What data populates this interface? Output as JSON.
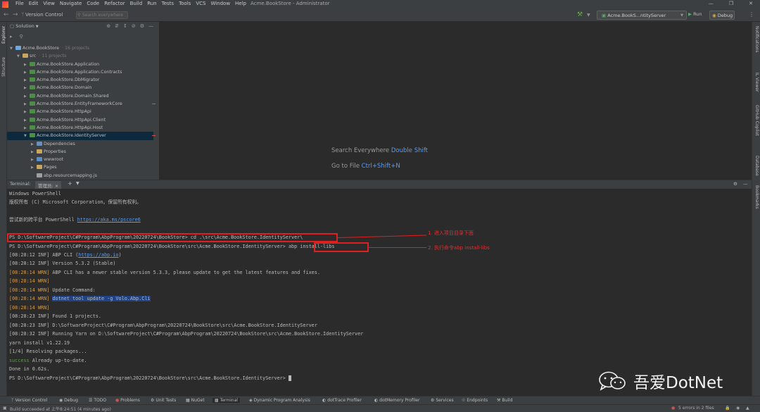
{
  "window": {
    "title": "Acme.BookStore - Administrator",
    "menu": [
      "File",
      "Edit",
      "View",
      "Navigate",
      "Code",
      "Refactor",
      "Build",
      "Run",
      "Tests",
      "Tools",
      "VCS",
      "Window",
      "Help"
    ],
    "controls": [
      "—",
      "❐",
      "✕"
    ]
  },
  "navbar": {
    "vcs_label": "Version Control",
    "search_placeholder": "Search everywhere",
    "run_config": "Acme.BookS...ntityServer",
    "run_label": "Run",
    "debug_label": "Debug"
  },
  "left_stripe": {
    "explorer": "Explorer",
    "structure": "Structure"
  },
  "right_stripe": [
    "Notifications",
    "IL Viewer",
    "GitHub Copilot",
    "Database",
    "Bookmarks"
  ],
  "explorer": {
    "header": "Solution",
    "tree": [
      {
        "label": "Acme.BookStore",
        "sub": "· 16 projects",
        "level": 0,
        "arrow": "down",
        "icon": "#6fa8dc"
      },
      {
        "label": "src",
        "sub": "· 11 projects",
        "level": 1,
        "arrow": "down",
        "icon": "#c9a65d"
      },
      {
        "label": "Acme.BookStore.Application",
        "level": 2,
        "arrow": "right",
        "icon": "#4a8f45"
      },
      {
        "label": "Acme.BookStore.Application.Contracts",
        "level": 2,
        "arrow": "right",
        "icon": "#4a8f45"
      },
      {
        "label": "Acme.BookStore.DbMigrator",
        "level": 2,
        "arrow": "right",
        "icon": "#4a8f45"
      },
      {
        "label": "Acme.BookStore.Domain",
        "level": 2,
        "arrow": "right",
        "icon": "#4a8f45"
      },
      {
        "label": "Acme.BookStore.Domain.Shared",
        "level": 2,
        "arrow": "right",
        "icon": "#4a8f45"
      },
      {
        "label": "Acme.BookStore.EntityFrameworkCore",
        "level": 2,
        "arrow": "right",
        "icon": "#4a8f45",
        "error": true
      },
      {
        "label": "Acme.BookStore.HttpApi",
        "level": 2,
        "arrow": "right",
        "icon": "#4a8f45"
      },
      {
        "label": "Acme.BookStore.HttpApi.Client",
        "level": 2,
        "arrow": "right",
        "icon": "#4a8f45"
      },
      {
        "label": "Acme.BookStore.HttpApi.Host",
        "level": 2,
        "arrow": "right",
        "icon": "#4a8f45"
      },
      {
        "label": "Acme.BookStore.IdentityServer",
        "level": 2,
        "arrow": "down",
        "icon": "#4a8f45",
        "selected": true,
        "error": true
      },
      {
        "label": "Dependencies",
        "level": 3,
        "arrow": "right",
        "icon": "#6a8fbd"
      },
      {
        "label": "Properties",
        "level": 3,
        "arrow": "right",
        "icon": "#c9a65d"
      },
      {
        "label": "wwwroot",
        "level": 3,
        "arrow": "right",
        "icon": "#5b8dc9"
      },
      {
        "label": "Pages",
        "level": 3,
        "arrow": "right",
        "icon": "#c9a65d"
      },
      {
        "label": "abp.resourcemapping.js",
        "level": 3,
        "arrow": "none",
        "icon": "#a0a0a0"
      }
    ]
  },
  "editor": {
    "hint1_label": "Search Everywhere",
    "hint1_key": "Double Shift",
    "hint2_label": "Go to File",
    "hint2_key": "Ctrl+Shift+N"
  },
  "terminal": {
    "label": "Terminal:",
    "tab": "管理员:",
    "lines": {
      "l1": "Windows PowerShell",
      "l2": "版权所有 (C) Microsoft Corporation。保留所有权利。",
      "l4a": "尝试新的跨平台 PowerShell ",
      "l4b": "https://aka.ms/pscore6",
      "l6": "PS D:\\SoftwareProject\\C#Program\\AbpProgram\\20220724\\BookStore> cd .\\src\\Acme.BookStore.IdentityServer\\",
      "l7a": "PS D:\\SoftwareProject\\C#Program\\AbpProgram\\20220724\\BookStore\\src\\Acme.BookStore.IdentityServer> ",
      "l7b": "abp install-libs",
      "l8t": "[08:28:12 INF]",
      "l8a": "ABP CLI (",
      "l8b": "https://abp.io",
      "l8c": ")",
      "l9t": "[08:28:12 INF]",
      "l9": "Version 5.3.2 (Stable)",
      "l10t": "[08:28:14 WRN]",
      "l10": "ABP CLI has a newer stable version 5.3.3, please update to get the latest features and fixes.",
      "l11t": "[08:28:14 WRN]",
      "l12t": "[08:28:14 WRN]",
      "l12": "Update Command:",
      "l13t": "[08:28:14 WRN]",
      "l13": "dotnet tool update -g Volo.Abp.Cli",
      "l14t": "[08:28:14 WRN]",
      "l15t": "[08:28:23 INF]",
      "l15": "Found 1 projects.",
      "l16t": "[08:28:23 INF]",
      "l16": "D:\\SoftwareProject\\C#Program\\AbpProgram\\20220724\\BookStore\\src\\Acme.BookStore.IdentityServer",
      "l17t": "[08:28:32 INF]",
      "l17": "Running Yarn on D:\\SoftwareProject\\C#Program\\AbpProgram\\20220724\\BookStore\\src\\Acme.BookStore.IdentityServer",
      "l18": "yarn install v1.22.19",
      "l19": "[1/4] Resolving packages...",
      "l20a": "success",
      "l20b": " Already up-to-date.",
      "l21": "Done in 0.62s.",
      "l22": "PS D:\\SoftwareProject\\C#Program\\AbpProgram\\20220724\\BookStore\\src\\Acme.BookStore.IdentityServer> "
    },
    "annotation1": "1. 进入项目目录下面",
    "annotation2": "2. 执行命令abp install-libs",
    "watermark": "吾爱DotNet"
  },
  "toolwindows": [
    "Version Control",
    "Debug",
    "TODO",
    "Problems",
    "Unit Tests",
    "NuGet",
    "Terminal",
    "Dynamic Program Analysis",
    "dotTrace Profiler",
    "dotMemory Profiler",
    "Services",
    "Endpoints",
    "Build"
  ],
  "status": {
    "message": "Build succeeded at 上午8:24:51 (4 minutes ago)",
    "errors": "5 errors in 2 files"
  },
  "colors": {
    "accent": "#589df6",
    "warn": "#d79b4b",
    "annotation": "#e02020",
    "selection": "#0d293e"
  }
}
